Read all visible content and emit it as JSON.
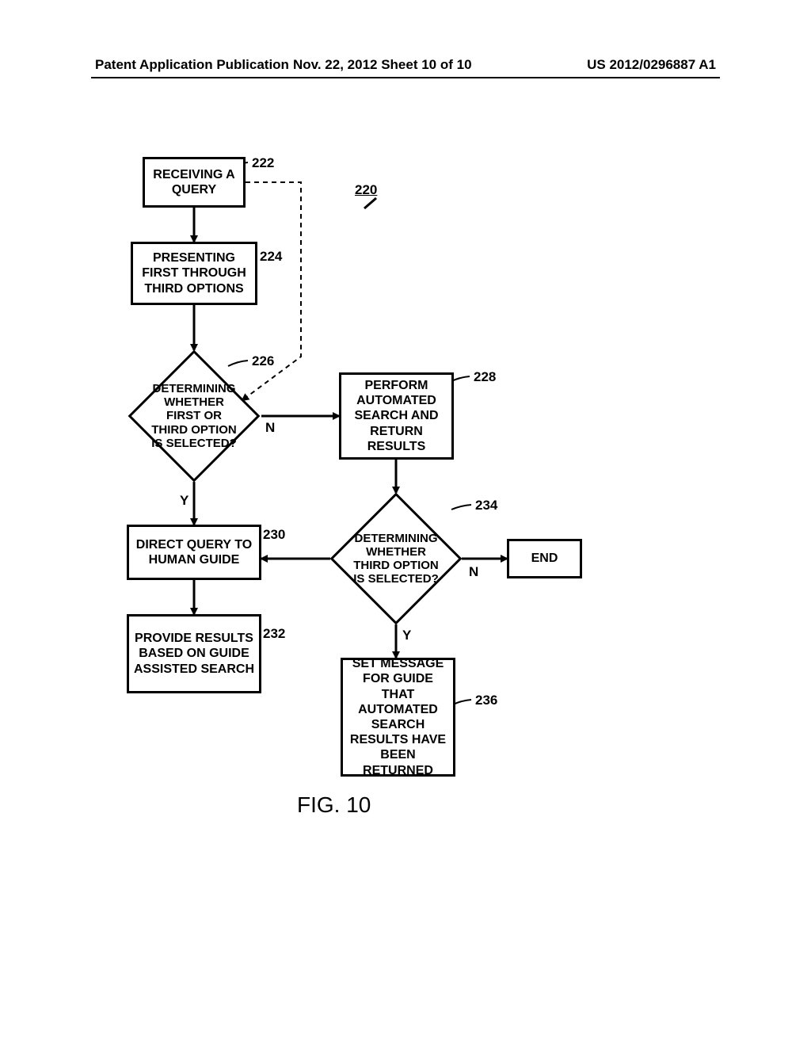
{
  "header": {
    "left": "Patent Application Publication",
    "center": "Nov. 22, 2012  Sheet 10 of 10",
    "right": "US 2012/0296887 A1"
  },
  "refs": {
    "r220": "220",
    "r222": "222",
    "r224": "224",
    "r226": "226",
    "r228": "228",
    "r230": "230",
    "r232": "232",
    "r234": "234",
    "r236": "236"
  },
  "nodes": {
    "b222": "RECEIVING A QUERY",
    "b224": "PRESENTING FIRST THROUGH THIRD OPTIONS",
    "d226": "DETERMINING WHETHER FIRST OR THIRD OPTION IS SELECTED?",
    "b228": "PERFORM AUTOMATED SEARCH AND RETURN RESULTS",
    "b230": "DIRECT QUERY TO HUMAN GUIDE",
    "b232": "PROVIDE RESULTS BASED ON GUIDE ASSISTED SEARCH",
    "d234": "DETERMINING WHETHER THIRD OPTION IS SELECTED?",
    "end": "END",
    "b236": "SET MESSAGE FOR GUIDE THAT AUTOMATED SEARCH RESULTS HAVE BEEN RETURNED"
  },
  "edges": {
    "y": "Y",
    "n": "N"
  },
  "fig": "FIG. 10"
}
